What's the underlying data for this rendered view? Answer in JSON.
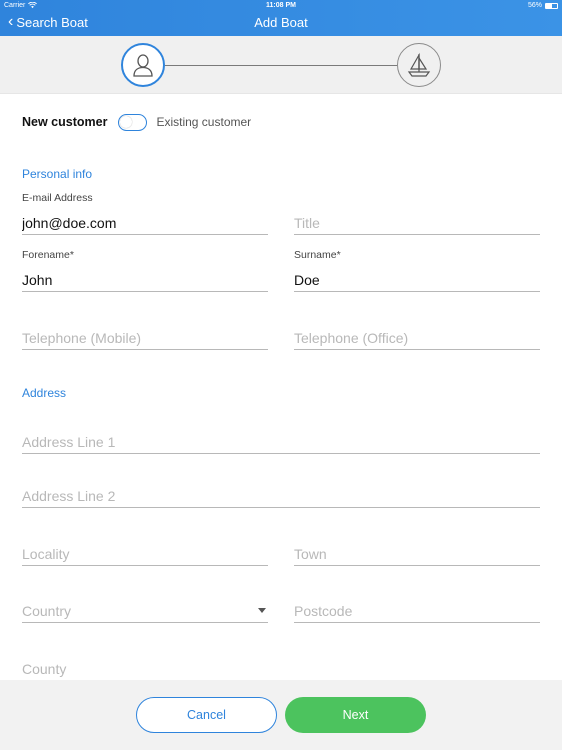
{
  "status_bar": {
    "carrier": "Carrier",
    "time": "11:08 PM",
    "battery": "56%",
    "battery_level": 0.56
  },
  "nav": {
    "back_label": "Search Boat",
    "title": "Add Boat"
  },
  "stepper": {
    "steps": [
      {
        "name": "customer",
        "icon": "person-icon",
        "active": true
      },
      {
        "name": "boat",
        "icon": "sailboat-icon",
        "active": false
      }
    ]
  },
  "toggle": {
    "left_label": "New customer",
    "right_label": "Existing customer",
    "on": false
  },
  "sections": {
    "personal": "Personal info",
    "address": "Address"
  },
  "fields": {
    "email": {
      "label": "E-mail Address",
      "value": "john@doe.com"
    },
    "title": {
      "placeholder": "Title"
    },
    "forename": {
      "label": "Forename*",
      "value": "John"
    },
    "surname": {
      "label": "Surname*",
      "value": "Doe"
    },
    "tel_mobile": {
      "placeholder": "Telephone (Mobile)"
    },
    "tel_office": {
      "placeholder": "Telephone (Office)"
    },
    "addr1": {
      "placeholder": "Address Line 1"
    },
    "addr2": {
      "placeholder": "Address Line 2"
    },
    "locality": {
      "placeholder": "Locality"
    },
    "town": {
      "placeholder": "Town"
    },
    "country": {
      "placeholder": "Country"
    },
    "postcode": {
      "placeholder": "Postcode"
    },
    "county": {
      "placeholder": "County"
    }
  },
  "buttons": {
    "cancel": "Cancel",
    "next": "Next"
  },
  "colors": {
    "accent": "#2f84dc",
    "success": "#4cc35e"
  }
}
